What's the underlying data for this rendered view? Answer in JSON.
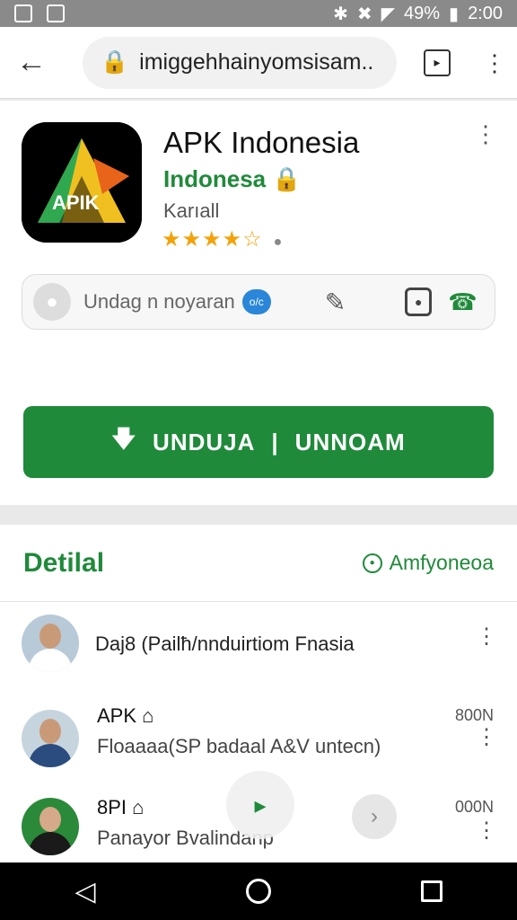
{
  "status": {
    "time": "2:00",
    "battery": "49%"
  },
  "browser": {
    "url": "imiggehhainyomsisam..",
    "tab_icon": "▸"
  },
  "app": {
    "title": "APK Indonesia",
    "developer": "Indonesa",
    "category": "Karıall",
    "rating": 3.5,
    "stars": "★★★★☆",
    "icon_text": "APIK",
    "search_text": "Undag n noyaran",
    "chat_icon_text": "o/c",
    "download_left": "UNDUJA",
    "download_right": "UNNOAM",
    "download_sep": "|"
  },
  "detail": {
    "title": "Detilal",
    "link": "Amfyoneoa",
    "rows": [
      {
        "text": "Daj8 (Pailħ/nnduirtiom Fnasia"
      },
      {
        "title": "APK",
        "sub": "Floaaaa(SP badaal A&V untecn)",
        "right": "800N"
      },
      {
        "title": "8PI",
        "sub": "Panayor Bvalindanp",
        "right": "000N"
      }
    ]
  },
  "colors": {
    "accent": "#1f8a3a"
  }
}
